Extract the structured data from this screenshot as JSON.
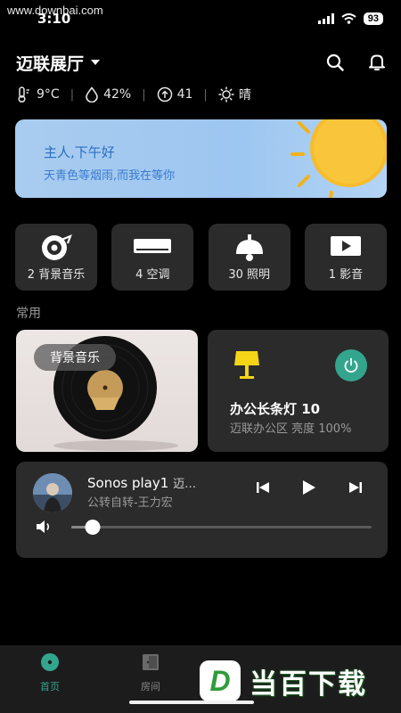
{
  "watermark": {
    "url": "www.downbai.com",
    "logo_letter": "D",
    "logo_text": "当百下载"
  },
  "status_bar": {
    "time": "3:10",
    "battery": "93"
  },
  "header": {
    "home_name": "迈联展厅"
  },
  "weather": {
    "temperature": "9°C",
    "humidity": "42%",
    "air_quality": "41",
    "condition": "晴"
  },
  "greeting": {
    "title": "主人,下午好",
    "subtitle": "天青色等烟雨,而我在等你"
  },
  "categories": [
    {
      "label": "2 背景音乐",
      "icon": "music-disc-icon"
    },
    {
      "label": "4 空调",
      "icon": "air-conditioner-icon"
    },
    {
      "label": "30 照明",
      "icon": "ceiling-lamp-icon"
    },
    {
      "label": "1 影音",
      "icon": "play-screen-icon"
    }
  ],
  "common": {
    "section_title": "常用",
    "music_card": {
      "label": "背景音乐"
    },
    "lamp_card": {
      "name": "办公长条灯 10",
      "status": "迈联办公区 亮度 100%"
    }
  },
  "player": {
    "name": "Sonos play1",
    "room": "迈…",
    "song": "公转自转-王力宏",
    "volume_fraction": 0.07
  },
  "tabbar": {
    "tabs": [
      {
        "label": "首页"
      },
      {
        "label": "房间"
      }
    ]
  },
  "colors": {
    "accent": "#34a58d",
    "background": "#000000",
    "card": "#2b2b2b",
    "greeting_text": "#2a6ec1",
    "lamp_yellow": "#f5d418"
  }
}
